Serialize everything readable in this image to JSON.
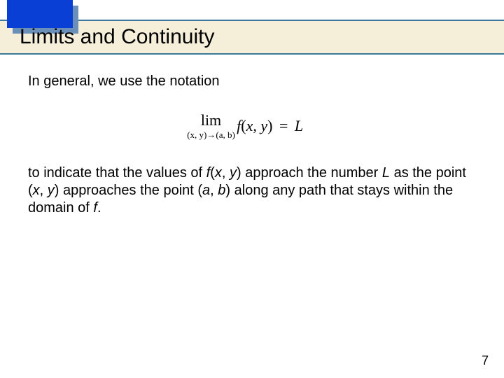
{
  "header": {
    "title": "Limits and Continuity"
  },
  "body": {
    "intro": "In general, we use the notation",
    "equation": {
      "lim_label": "lim",
      "lim_sub": "(x, y)→(a, b)",
      "rhs_f": "f",
      "rhs_open": "(",
      "rhs_x": "x",
      "rhs_comma": ", ",
      "rhs_y": "y",
      "rhs_close": ")",
      "rhs_eq": " = ",
      "rhs_L": "L"
    },
    "para2_part1": "to indicate that the values of ",
    "para2_fxy": "f",
    "para2_open1": "(",
    "para2_x1": "x",
    "para2_c1": ", ",
    "para2_y1": "y",
    "para2_close1": ")",
    "para2_part2": " approach the number ",
    "para2_L": "L",
    "para2_part3": " as the point (",
    "para2_x2": "x",
    "para2_c2": ", ",
    "para2_y2": "y",
    "para2_part4": ") approaches the point (",
    "para2_a": "a",
    "para2_c3": ", ",
    "para2_b": "b",
    "para2_part5": ") along any path that stays within the domain of ",
    "para2_f2": "f",
    "para2_period": "."
  },
  "pageNumber": "7"
}
